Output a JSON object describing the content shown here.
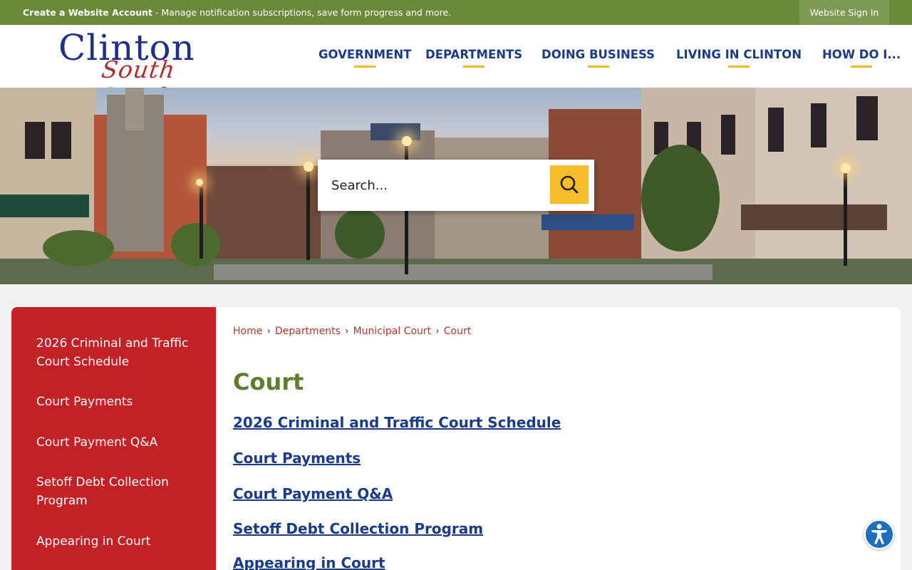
{
  "topbar": {
    "create_account": "Create a Website Account",
    "message": " - Manage notification subscriptions, save form progress and more.",
    "sign_in": "Website Sign In"
  },
  "logo": {
    "line1": "Clinton",
    "line2": "South Carolina"
  },
  "nav": {
    "items": [
      {
        "label": "GOVERNMENT"
      },
      {
        "label": "DEPARTMENTS"
      },
      {
        "label": "DOING BUSINESS"
      },
      {
        "label": "LIVING IN CLINTON"
      },
      {
        "label": "HOW DO I..."
      }
    ]
  },
  "search": {
    "placeholder": "Search..."
  },
  "sidebar": {
    "items": [
      {
        "label": "2026 Criminal and Traffic Court Schedule"
      },
      {
        "label": "Court Payments"
      },
      {
        "label": "Court Payment Q&A"
      },
      {
        "label": "Setoff Debt Collection Program"
      },
      {
        "label": "Appearing in Court"
      }
    ]
  },
  "breadcrumb": {
    "items": [
      "Home",
      "Departments",
      "Municipal Court",
      "Court"
    ],
    "separator": "›"
  },
  "main": {
    "title": "Court",
    "links": [
      {
        "label": "2026 Criminal and Traffic Court Schedule"
      },
      {
        "label": "Court Payments"
      },
      {
        "label": "Court Payment Q&A"
      },
      {
        "label": "Setoff Debt Collection Program"
      },
      {
        "label": "Appearing in Court"
      }
    ]
  },
  "colors": {
    "topbar": "#6a8a3a",
    "nav_text": "#1a3a8a",
    "nav_underline": "#f1b82a",
    "sidebar": "#c42127",
    "title": "#5e7f2f",
    "link": "#1a3a8a",
    "search_button": "#f5bd2a"
  },
  "icons": {
    "search": "search-icon",
    "accessibility": "accessibility-icon"
  }
}
